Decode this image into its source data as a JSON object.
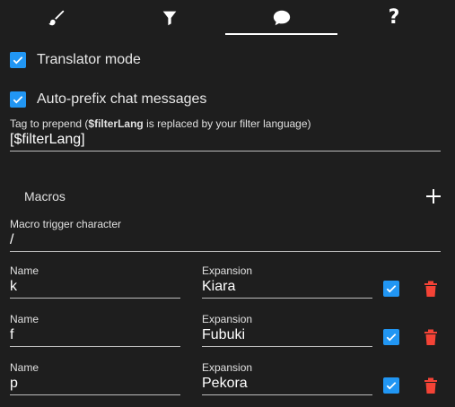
{
  "tabs": [
    {
      "name": "appearance",
      "icon": "paintbrush-icon"
    },
    {
      "name": "filter",
      "icon": "filter-icon"
    },
    {
      "name": "chat",
      "icon": "chat-bubble-icon",
      "active": true
    },
    {
      "name": "help",
      "icon": "help-icon",
      "glyph": "?"
    }
  ],
  "settings": {
    "translator_mode": {
      "label": "Translator mode",
      "checked": true
    },
    "auto_prefix": {
      "label": "Auto-prefix chat messages",
      "checked": true
    },
    "tag": {
      "label_pre": "Tag to prepend (",
      "label_bold": "$filterLang",
      "label_post": " is replaced by your filter language)",
      "value": "[$filterLang]"
    }
  },
  "macros": {
    "title": "Macros",
    "trigger": {
      "label": "Macro trigger character",
      "value": "/"
    },
    "name_label": "Name",
    "expansion_label": "Expansion",
    "rows": [
      {
        "name": "k",
        "expansion": "Kiara",
        "enabled": true
      },
      {
        "name": "f",
        "expansion": "Fubuki",
        "enabled": true
      },
      {
        "name": "p",
        "expansion": "Pekora",
        "enabled": true
      }
    ]
  },
  "colors": {
    "background": "#1e1e1e",
    "accent": "#2196f3",
    "delete": "#f44336",
    "text": "#ffffff"
  }
}
